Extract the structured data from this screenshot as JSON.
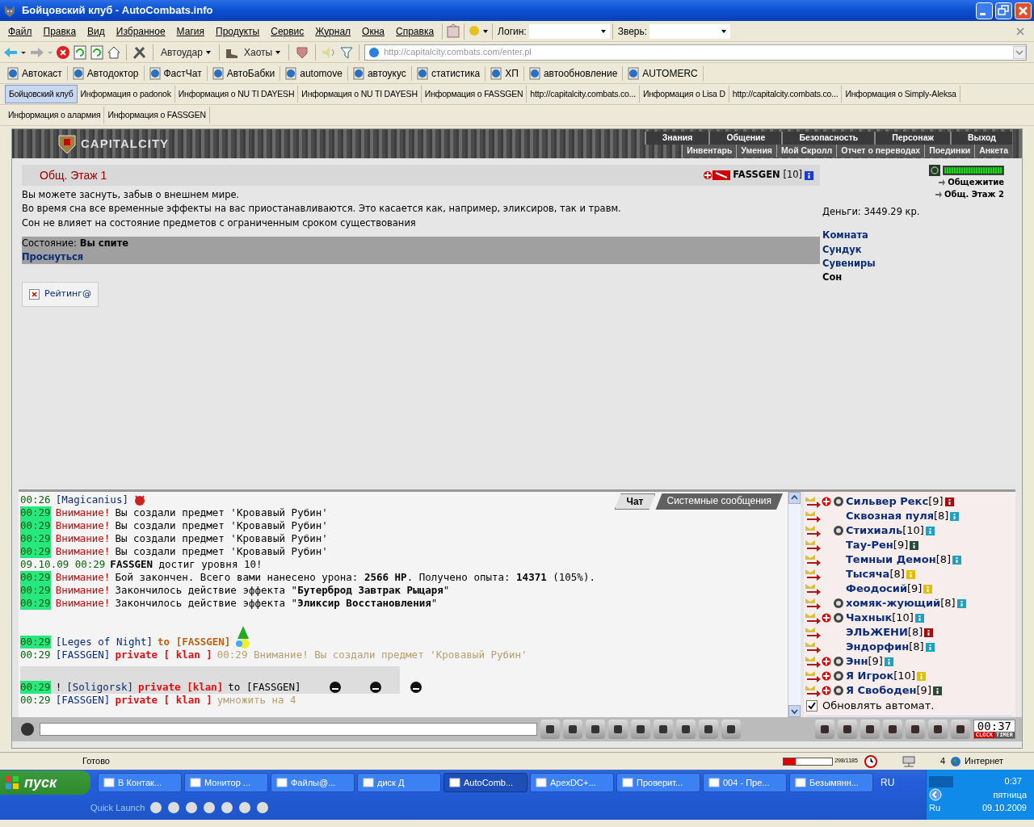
{
  "window": {
    "title": "Бойцовский клуб - AutoCombats.info"
  },
  "menu": [
    "Файл",
    "Правка",
    "Вид",
    "Избранное",
    "Магия",
    "Продукты",
    "Сервис",
    "Журнал",
    "Окна",
    "Справка"
  ],
  "login": {
    "label": "Логин:"
  },
  "beast": {
    "label": "Зверь:"
  },
  "toolbar": {
    "autoattack": "Автоудар",
    "chaos": "Хаоты",
    "address": "http://capitalcity.combats.com/enter.pl"
  },
  "links": [
    "Автокаст",
    "Автодоктор",
    "ФастЧат",
    "АвтоБабки",
    "automove",
    "автоукус",
    "статистика",
    "ХП",
    "автообновление",
    "AUTOMERC"
  ],
  "tab_rows": [
    [
      {
        "label": "Бойцовский клуб",
        "selected": true
      },
      {
        "label": "Информация о padonok",
        "selected": false
      },
      {
        "label": "Информация о NU TI DAYESH",
        "selected": false
      },
      {
        "label": "Информация о NU TI DAYESH",
        "selected": false
      },
      {
        "label": "Информация о FASSGEN",
        "selected": false
      },
      {
        "label": "http://capitalcity.combats.co...",
        "selected": false
      },
      {
        "label": "Информация о Lisa D",
        "selected": false
      },
      {
        "label": "http://capitalcity.combats.co...",
        "selected": false
      },
      {
        "label": "Информация о Simply-Aleksa",
        "selected": false
      }
    ],
    [
      {
        "label": "Информация о алармия",
        "selected": false
      },
      {
        "label": "Информация о FASSGEN",
        "selected": false
      }
    ]
  ],
  "game": {
    "logo": "CAPITALCITY",
    "nav_top": [
      "Знания",
      "Общение",
      "Безопасность",
      "Персонаж",
      "Выход"
    ],
    "nav_bottom": [
      "Инвентарь",
      "Умения",
      "Мой Скролл",
      "Отчет о переводах",
      "Поединки",
      "Анкета"
    ],
    "room": {
      "title": "Общ. Этаж 1",
      "player": "FASSGEN",
      "level": "[10]",
      "description": [
        "Вы можете заснуть, забыв о внешнем мире.",
        "Во время сна все временные эффекты на вас приостанавливаются. Это касается как, например, эликсиров, так и травм.",
        "Сон не влияет на состояние предметов с ограниченным сроком существования"
      ],
      "state_label": "Состояние:",
      "state_value": "Вы спите",
      "wake": "Проснуться",
      "rating": "Рейтинг@"
    },
    "side": {
      "hp": {
        "level": 1.0
      },
      "exits": [
        "Общежитие",
        "Общ. Этаж 2"
      ],
      "money": "Деньги: 3449.29 кр.",
      "links": [
        {
          "label": "Комната",
          "selected": false
        },
        {
          "label": "Сундук",
          "selected": false
        },
        {
          "label": "Сувениры",
          "selected": false
        },
        {
          "label": "Сон",
          "selected": true
        }
      ]
    }
  },
  "chat": {
    "tabs": [
      {
        "label": "Чат",
        "selected": true
      },
      {
        "label": "Системные сообщения",
        "selected": false
      }
    ],
    "messages": [
      {
        "time": "00:26",
        "highlighted": false,
        "parts": [
          {
            "kind": "nick",
            "text": "[Magicanius]"
          }
        ],
        "emoticons": [
          {
            "kind": "devil"
          }
        ]
      },
      {
        "time": "00:29",
        "highlighted": true,
        "parts": [
          {
            "kind": "warn",
            "text": "Внимание!"
          },
          {
            "kind": "text",
            "text": "Вы создали предмет 'Кровавый Рубин'"
          }
        ]
      },
      {
        "time": "00:29",
        "highlighted": true,
        "parts": [
          {
            "kind": "warn",
            "text": "Внимание!"
          },
          {
            "kind": "text",
            "text": "Вы создали предмет 'Кровавый Рубин'"
          }
        ]
      },
      {
        "time": "00:29",
        "highlighted": true,
        "parts": [
          {
            "kind": "warn",
            "text": "Внимание!"
          },
          {
            "kind": "text",
            "text": "Вы создали предмет 'Кровавый Рубин'"
          }
        ]
      },
      {
        "time": "00:29",
        "highlighted": true,
        "parts": [
          {
            "kind": "warn",
            "text": "Внимание!"
          },
          {
            "kind": "text",
            "text": "Вы создали предмет 'Кровавый Рубин'"
          }
        ]
      },
      {
        "time": "09.10.09 00:29",
        "highlighted": false,
        "parts": [
          {
            "kind": "text",
            "text": "**FASSGEN** достиг уровня 10!"
          }
        ]
      },
      {
        "time": "00:29",
        "highlighted": true,
        "parts": [
          {
            "kind": "warn",
            "text": "Внимание!"
          },
          {
            "kind": "text",
            "text": "Бой закончен. Всего вами нанесено урона: **2566 HP**. Получено опыта: **14371** (105%)."
          }
        ]
      },
      {
        "time": "00:29",
        "highlighted": true,
        "parts": [
          {
            "kind": "warn",
            "text": "Внимание!"
          },
          {
            "kind": "text",
            "text": "Закончилось действие эффекта \"**Бутерброд Завтрак Рыцаря**\""
          }
        ]
      },
      {
        "time": "00:29",
        "highlighted": true,
        "parts": [
          {
            "kind": "warn",
            "text": "Внимание!"
          },
          {
            "kind": "text",
            "text": "Закончилось действие эффекта \"**Эликсир Восстановления**\""
          }
        ]
      },
      {
        "time": "00:29",
        "highlighted": true,
        "parts": [
          {
            "kind": "nick",
            "text": "[Leges of Night]"
          },
          {
            "kind": "to_nick",
            "text": "to [FASSGEN]"
          }
        ],
        "emoticons": [
          {
            "kind": "tree"
          }
        ]
      },
      {
        "time": "00:29",
        "highlighted": false,
        "parts": [
          {
            "kind": "nick",
            "text": "[FASSGEN]"
          },
          {
            "kind": "private",
            "text": "private [ klan ]"
          },
          {
            "kind": "faded",
            "text": "00:29 Внимание! Вы создали предмет 'Кровавый Рубин'"
          }
        ]
      },
      {
        "time": "00:29",
        "highlighted": true,
        "shaded": true,
        "parts": [
          {
            "kind": "text",
            "text": "!"
          },
          {
            "kind": "nick",
            "text": "[Soligorsk]"
          },
          {
            "kind": "private",
            "text": "private [klan]"
          },
          {
            "kind": "text",
            "text": "to [FASSGEN]"
          }
        ],
        "emoticons": [
          {
            "kind": "ghost"
          },
          {
            "kind": "ghost"
          },
          {
            "kind": "ghost"
          }
        ]
      },
      {
        "time": "00:29",
        "highlighted": false,
        "parts": [
          {
            "kind": "nick",
            "text": "[FASSGEN]"
          },
          {
            "kind": "private",
            "text": "private [ klan ]"
          },
          {
            "kind": "faded",
            "text": "умножить на 4"
          }
        ]
      }
    ]
  },
  "users": [
    {
      "name": "Сильвер Рекс",
      "level": "[9]",
      "color": "#a01010",
      "clan": true,
      "emblem": true
    },
    {
      "name": "Сквозная пуля",
      "level": "[8]",
      "color": "#20a0c0",
      "clan": false,
      "emblem": false
    },
    {
      "name": "Стихиаль",
      "level": "[10]",
      "color": "#20a0c0",
      "clan": false,
      "emblem": true
    },
    {
      "name": "Тау-Рен",
      "level": "[9]",
      "color": "#2a4a3a",
      "clan": false,
      "emblem": false
    },
    {
      "name": "Темныи Демон",
      "level": "[8]",
      "color": "#20a0c0",
      "clan": false,
      "emblem": false
    },
    {
      "name": "Тысяча",
      "level": "[8]",
      "color": "#e0c000",
      "clan": false,
      "emblem": false
    },
    {
      "name": "Феодосий",
      "level": "[9]",
      "color": "#e0c000",
      "clan": false,
      "emblem": false
    },
    {
      "name": "хомяк-жующий",
      "level": "[8]",
      "color": "#20a0c0",
      "clan": false,
      "emblem": true
    },
    {
      "name": "Чахнык",
      "level": "[10]",
      "color": "#20a0c0",
      "clan": true,
      "emblem": true
    },
    {
      "name": "ЭЛЬЖЕНИ",
      "level": "[8]",
      "color": "#a01010",
      "clan": false,
      "emblem": false
    },
    {
      "name": "Эндорфин",
      "level": "[8]",
      "color": "#20a0c0",
      "clan": false,
      "emblem": false
    },
    {
      "name": "Энн",
      "level": "[9]",
      "color": "#20a0c0",
      "clan": true,
      "emblem": true
    },
    {
      "name": "Я Игрок",
      "level": "[10]",
      "color": "#e0c000",
      "clan": true,
      "emblem": true
    },
    {
      "name": "Я Свободен",
      "level": "[9]",
      "color": "#2a4a3a",
      "clan": true,
      "emblem": true
    }
  ],
  "autoupdate": {
    "label": "Обновлять автомат.",
    "checked": true
  },
  "clock": {
    "time": "00:37",
    "modes": [
      "CLOCK",
      "TIMER"
    ]
  },
  "status_bar": {
    "text": "Готово",
    "progress": "298/1185",
    "level": 0.25,
    "zone": "4",
    "internet": "Интернет"
  },
  "taskbar": {
    "start": "пуск",
    "tasks": [
      {
        "label": "В Контак...",
        "selected": false
      },
      {
        "label": "Монитор ...",
        "selected": false
      },
      {
        "label": "Файлы@...",
        "selected": false
      },
      {
        "label": "диск Д",
        "selected": false
      },
      {
        "label": "AutoComb...",
        "selected": true
      },
      {
        "label": "ApexDC+...",
        "selected": false
      },
      {
        "label": "Проверит...",
        "selected": false
      },
      {
        "label": "004 - Пре...",
        "selected": false
      },
      {
        "label": "Безымянн...",
        "selected": false
      }
    ],
    "quick_launch": "Quick Launch",
    "lang": "RU",
    "tray_lang": "Ru",
    "time": "0:37",
    "day": "пятница",
    "date": "09.10.2009"
  }
}
